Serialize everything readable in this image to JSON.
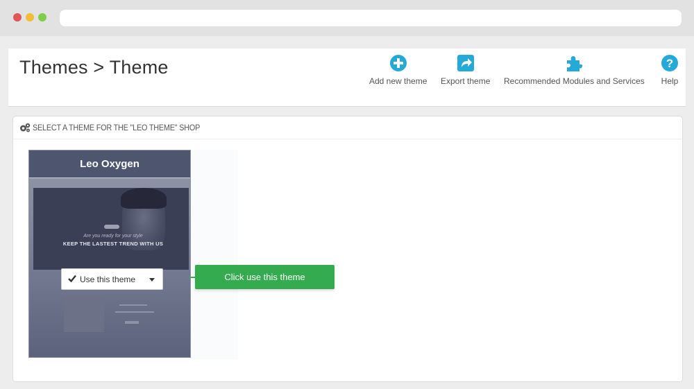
{
  "header": {
    "title": "Themes > Theme",
    "actions": [
      {
        "label": "Add new theme",
        "icon": "plus-circle-icon"
      },
      {
        "label": "Export theme",
        "icon": "export-icon"
      },
      {
        "label": "Recommended Modules and Services",
        "icon": "puzzle-icon"
      },
      {
        "label": "Help",
        "icon": "help-icon"
      }
    ]
  },
  "panel": {
    "heading": "SELECT A THEME FOR THE \"LEO THEME\" SHOP",
    "theme_card": {
      "name": "Leo Oxygen",
      "preview_tagline": "Are you ready for your style",
      "preview_headline": "KEEP THE LASTEST TREND WITH US",
      "use_button_label": "Use this theme"
    },
    "callout": "Click use this theme"
  },
  "colors": {
    "accent": "#25a9d9",
    "callout_green": "#33ab4e",
    "card_header": "#4e556f"
  }
}
